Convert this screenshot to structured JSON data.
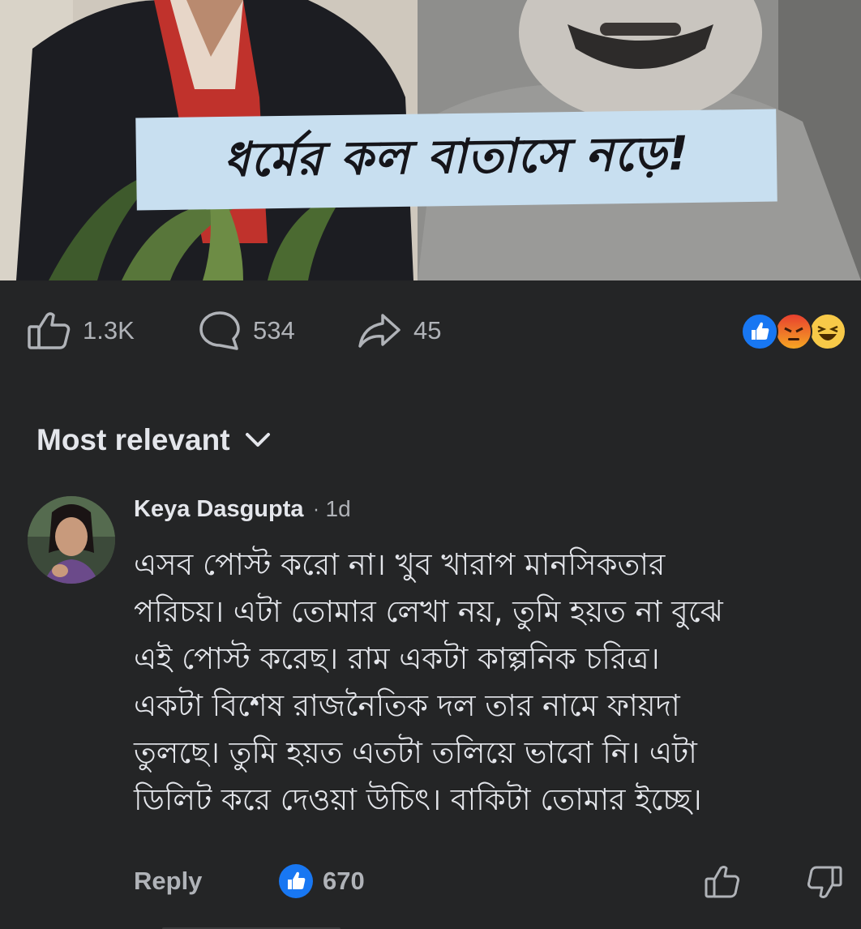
{
  "post": {
    "caption": "ধর্মের কল বাতাসে নড়ে!"
  },
  "stats": {
    "likes": "1.3K",
    "comments": "534",
    "shares": "45"
  },
  "reactions": [
    "like-icon",
    "angry-icon",
    "haha-icon"
  ],
  "sort": {
    "label": "Most relevant"
  },
  "comment": {
    "author": "Keya Dasgupta",
    "separator": "·",
    "time": "1d",
    "lines": [
      "এসব পোস্ট করো না। খুব খারাপ মানসিকতার",
      "পরিচয়। এটা তোমার লেখা নয়, তুমি হয়ত না বুঝে",
      "এই পোস্ট করেছ। রাম একটা কাল্পনিক চরিত্র।",
      "একটা বিশেষ রাজনৈতিক দল তার নামে ফায়দা",
      "তুলছে। তুমি হয়ত এতটা তলিয়ে ভাবো নি। এটা",
      "ডিলিট করে দেওয়া উচিৎ। বাকিটা তোমার ইচ্ছে।"
    ],
    "reply_label": "Reply",
    "like_count": "670"
  },
  "colors": {
    "background": "#242526",
    "text_primary": "#e4e6eb",
    "text_secondary": "#b0b3b8",
    "accent_blue": "#1877f2",
    "caption_bg": "#c8dff0"
  }
}
